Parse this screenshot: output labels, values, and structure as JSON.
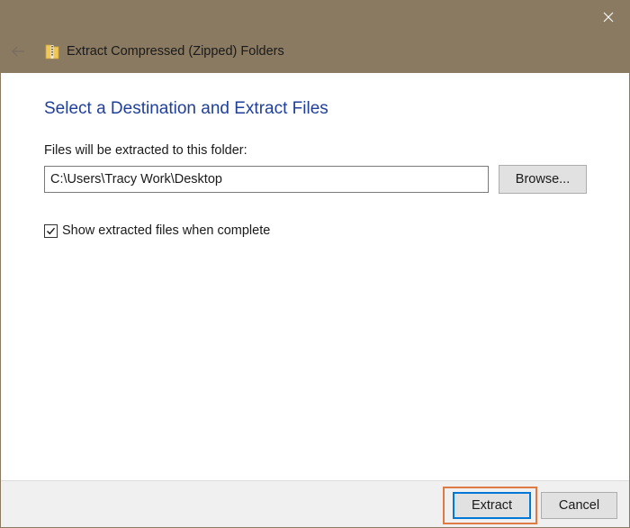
{
  "window": {
    "title": "Extract Compressed (Zipped) Folders",
    "title_icon": "zip-folder-icon",
    "close_icon": "close-icon",
    "back_icon": "back-arrow-icon",
    "titlebar_color": "#8a7a62"
  },
  "main": {
    "heading": "Select a Destination and Extract Files",
    "heading_color": "#1f3f9a",
    "destination_label": "Files will be extracted to this folder:",
    "destination_value": "C:\\Users\\Tracy Work\\Desktop",
    "browse_label": "Browse...",
    "show_files_checkbox": {
      "label": "Show extracted files when complete",
      "checked": true
    }
  },
  "footer": {
    "extract_label": "Extract",
    "cancel_label": "Cancel",
    "highlight_color": "#e07a45",
    "focus_color": "#0078d7"
  }
}
